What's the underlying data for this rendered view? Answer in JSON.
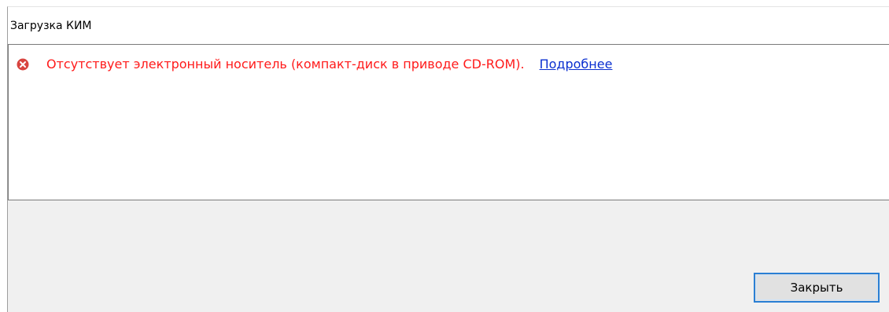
{
  "window": {
    "title": "Загрузка КИМ"
  },
  "message": {
    "icon": "error-icon",
    "text": "Отсутствует электронный носитель (компакт-диск в приводе CD-ROM).",
    "link_label": "Подробнее",
    "text_color": "#ff1a1a",
    "link_color": "#0a2fd0"
  },
  "footer": {
    "close_label": "Закрыть",
    "focus_color": "#2a7fd4"
  }
}
